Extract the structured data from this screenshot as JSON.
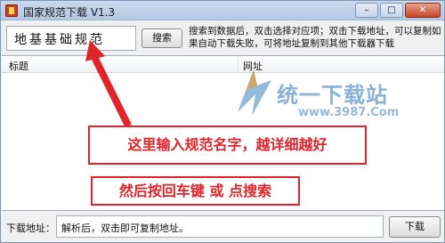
{
  "window": {
    "title": "国家规范下载 V1.3",
    "controls": {
      "minimize": "–",
      "maximize": "□",
      "close": "✕"
    }
  },
  "search": {
    "keyword_value": "地基基础规范",
    "search_label": "搜索",
    "hint": "搜索到数据后，双击选择对应项；双击下载地址，可以复制如果自动下载失败，可将地址复制到其他下载器下载"
  },
  "list": {
    "columns": [
      "标题",
      "网址"
    ]
  },
  "watermark": {
    "brand": "统一下载站",
    "url": "www.3987.Com"
  },
  "annotations": {
    "callout_1": "这里输入规范名字，越详细越好",
    "callout_2": "然后按回车键 或 点搜索"
  },
  "bottom": {
    "download_label": "下载地址：",
    "download_url_value": "解析后，双击即可复制地址。",
    "download_button": "下载"
  },
  "colors": {
    "annotation_red": "#e0242a",
    "watermark_blue": "#2a73b8"
  }
}
